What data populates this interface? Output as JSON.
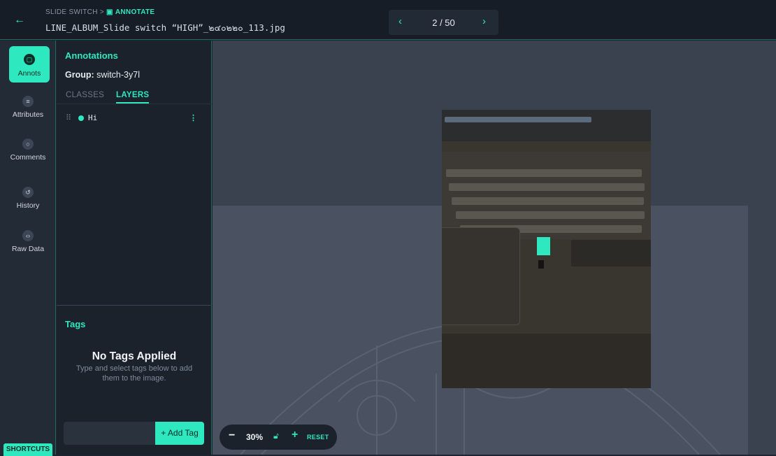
{
  "header": {
    "breadcrumb_parent": "SLIDE SWITCH",
    "breadcrumb_sep": ">",
    "breadcrumb_current": "ANNOTATE",
    "filename": "LINE_ALBUM_Slide switch “HIGH”_๒๔๐๒๒๐_113.jpg",
    "back_icon": "arrow-left-icon"
  },
  "pager": {
    "label": "2 / 50",
    "prev_icon": "chevron-left-icon",
    "next_icon": "chevron-right-icon"
  },
  "rail": {
    "items": [
      {
        "label": "Annots",
        "icon": "annotation-icon",
        "active": true
      },
      {
        "label": "Attributes",
        "icon": "list-icon"
      },
      {
        "label": "Comments",
        "icon": "comment-icon"
      },
      {
        "label": "History",
        "icon": "history-icon"
      },
      {
        "label": "Raw Data",
        "icon": "code-icon"
      }
    ],
    "shortcuts": "SHORTCUTS"
  },
  "panel": {
    "title": "Annotations",
    "group_label": "Group:",
    "group_value": "switch-3y7l",
    "tabs": [
      "CLASSES",
      "LAYERS"
    ],
    "active_tab": "LAYERS",
    "layers": [
      {
        "name": "Hi",
        "color": "#2ee8c0"
      }
    ],
    "tags_title": "Tags",
    "no_tags_title": "No Tags Applied",
    "no_tags_sub": "Type and select tags below to add them to the image.",
    "tag_input_value": "",
    "add_tag_label": "+ Add Tag"
  },
  "zoom": {
    "minus": "−",
    "value": "30%",
    "plus": "+",
    "reset": "RESET",
    "lock_icon": "lock-open-icon"
  },
  "colors": {
    "accent": "#2ee8c0",
    "background": "#1e2530",
    "canvas": "#3a4250"
  }
}
